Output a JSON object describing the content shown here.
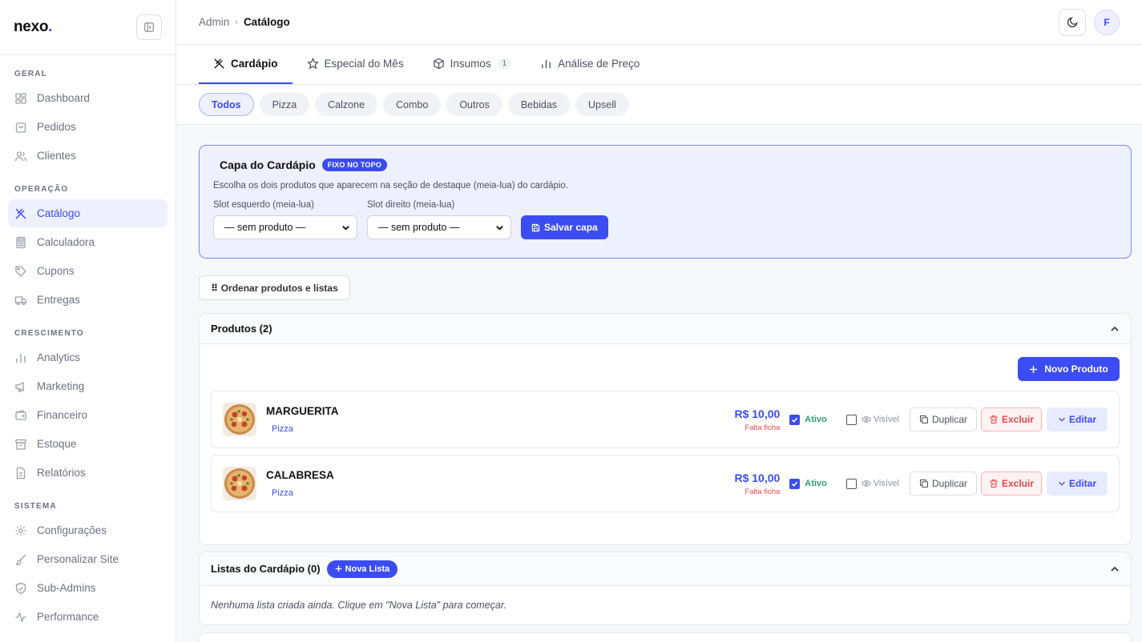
{
  "app": {
    "logo_text": "nexo",
    "logo_dot": "."
  },
  "sidebar": {
    "sections": [
      {
        "title": "GERAL",
        "items": [
          "Dashboard",
          "Pedidos",
          "Clientes"
        ]
      },
      {
        "title": "OPERAÇÃO",
        "items": [
          "Catálogo",
          "Calculadora",
          "Cupons",
          "Entregas"
        ]
      },
      {
        "title": "CRESCIMENTO",
        "items": [
          "Analytics",
          "Marketing",
          "Financeiro",
          "Estoque",
          "Relatórios"
        ]
      },
      {
        "title": "SISTEMA",
        "items": [
          "Configurações",
          "Personalizar Site",
          "Sub-Admins",
          "Performance"
        ]
      }
    ],
    "active_item": "Catálogo"
  },
  "breadcrumb": {
    "root": "Admin",
    "separator": "›",
    "current": "Catálogo"
  },
  "user": {
    "initial": "F"
  },
  "tabs": [
    {
      "label": "Cardápio",
      "icon": "utensils-icon",
      "active": true
    },
    {
      "label": "Especial do Mês",
      "icon": "star-icon"
    },
    {
      "label": "Insumos",
      "icon": "box-icon",
      "count": "1"
    },
    {
      "label": "Análise de Preço",
      "icon": "bar-chart-icon"
    }
  ],
  "filters": [
    "Todos",
    "Pizza",
    "Calzone",
    "Combo",
    "Outros",
    "Bebidas",
    "Upsell"
  ],
  "cover": {
    "title": "Capa do Cardápio",
    "badge": "FIXO NO TOPO",
    "description": "Escolha os dois produtos que aparecem na seção de destaque (meia-lua) do cardápio.",
    "left_label": "Slot esquerdo (meia-lua)",
    "left_value": "— sem produto —",
    "right_label": "Slot direito (meia-lua)",
    "right_value": "— sem produto —",
    "save_label": "Salvar capa"
  },
  "order_button": "⠿ Ordenar produtos e listas",
  "products_panel": {
    "title": "Produtos (2)",
    "new_button": "Novo Produto",
    "items": [
      {
        "name": "MARGUERITA",
        "category": "Pizza",
        "price": "R$ 10,00",
        "warning": "Falta ficha",
        "active_label": "Ativo",
        "visible_label": "Visível",
        "duplicate": "Duplicar",
        "delete": "Excluir",
        "edit": "Editar"
      },
      {
        "name": "CALABRESA",
        "category": "Pizza",
        "price": "R$ 10,00",
        "warning": "Falta ficha",
        "active_label": "Ativo",
        "visible_label": "Visível",
        "duplicate": "Duplicar",
        "delete": "Excluir",
        "edit": "Editar"
      }
    ]
  },
  "lists_panel": {
    "title": "Listas do Cardápio (0)",
    "new_button": "Nova Lista",
    "empty_text": "Nenhuma lista criada ainda. Clique em \"Nova Lista\" para começar."
  },
  "colors": {
    "accent": "#3b4cf3",
    "success": "#2f9e6e",
    "danger": "#e5484d"
  }
}
